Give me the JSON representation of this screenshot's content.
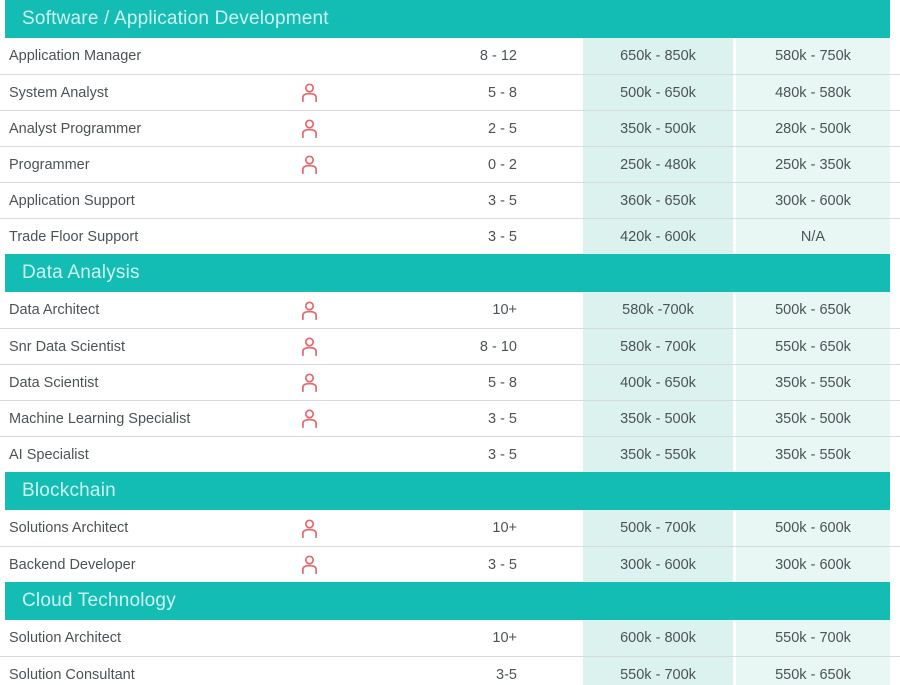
{
  "theme": {
    "header_bg": "#14bdb4",
    "header_text": "#cdf4f0",
    "row_text": "#4c5356",
    "salary_col1_bg": "#dcf2ef",
    "salary_col2_bg": "#e8f6f4",
    "icon_color": "#e4686b",
    "rule_color": "#d8dbdd"
  },
  "icons": {
    "person": "person-icon"
  },
  "sections": [
    {
      "title": "Software / Application Development",
      "rows": [
        {
          "job": "Application Manager",
          "icon": false,
          "experience": "8 - 12",
          "salary_a": "650k - 850k",
          "salary_b": "580k - 750k"
        },
        {
          "job": "System Analyst",
          "icon": true,
          "experience": "5 - 8",
          "salary_a": "500k - 650k",
          "salary_b": "480k - 580k"
        },
        {
          "job": "Analyst Programmer",
          "icon": true,
          "experience": "2 - 5",
          "salary_a": "350k - 500k",
          "salary_b": "280k - 500k"
        },
        {
          "job": "Programmer",
          "icon": true,
          "experience": "0 - 2",
          "salary_a": "250k - 480k",
          "salary_b": "250k - 350k"
        },
        {
          "job": "Application Support",
          "icon": false,
          "experience": "3 - 5",
          "salary_a": "360k - 650k",
          "salary_b": "300k - 600k"
        },
        {
          "job": "Trade Floor Support",
          "icon": false,
          "experience": "3 - 5",
          "salary_a": "420k - 600k",
          "salary_b": "N/A"
        }
      ]
    },
    {
      "title": "Data Analysis",
      "rows": [
        {
          "job": "Data Architect",
          "icon": true,
          "experience": "10+",
          "salary_a": "580k -700k",
          "salary_b": "500k - 650k"
        },
        {
          "job": "Snr Data Scientist",
          "icon": true,
          "experience": "8 - 10",
          "salary_a": "580k - 700k",
          "salary_b": "550k - 650k"
        },
        {
          "job": "Data Scientist",
          "icon": true,
          "experience": "5 - 8",
          "salary_a": "400k - 650k",
          "salary_b": "350k - 550k"
        },
        {
          "job": "Machine Learning Specialist",
          "icon": true,
          "experience": "3 - 5",
          "salary_a": "350k - 500k",
          "salary_b": "350k - 500k"
        },
        {
          "job": "AI Specialist",
          "icon": false,
          "experience": "3 - 5",
          "salary_a": "350k - 550k",
          "salary_b": "350k - 550k"
        }
      ]
    },
    {
      "title": "Blockchain",
      "rows": [
        {
          "job": "Solutions Architect",
          "icon": true,
          "experience": "10+",
          "salary_a": "500k - 700k",
          "salary_b": "500k - 600k"
        },
        {
          "job": "Backend Developer",
          "icon": true,
          "experience": "3 - 5",
          "salary_a": "300k - 600k",
          "salary_b": "300k - 600k"
        }
      ]
    },
    {
      "title": "Cloud Technology",
      "rows": [
        {
          "job": "Solution Architect",
          "icon": false,
          "experience": "10+",
          "salary_a": "600k - 800k",
          "salary_b": "550k - 700k"
        },
        {
          "job": "Solution Consultant",
          "icon": false,
          "experience": "3-5",
          "salary_a": "550k - 700k",
          "salary_b": "550k - 650k"
        }
      ]
    }
  ]
}
